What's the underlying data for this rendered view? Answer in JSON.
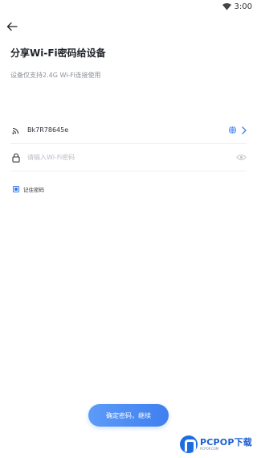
{
  "status_bar": {
    "time": "3:00",
    "icons": [
      "wifi-icon"
    ]
  },
  "nav": {
    "back_icon": "arrow-left-icon"
  },
  "header": {
    "title": "分享Wi-Fi密码给设备",
    "subtitle": "设备仅支持2.4G Wi-Fi连接使用"
  },
  "wifi_row": {
    "icon": "wifi-signal-icon",
    "ssid": "Bk7R78645e",
    "globe_icon": "globe-icon",
    "chevron_icon": "chevron-right-icon"
  },
  "password_row": {
    "icon": "lock-icon",
    "value": "",
    "placeholder": "请输入Wi-Fi密码",
    "eye_icon": "eye-icon"
  },
  "remember": {
    "label": "记住密码",
    "checked": true
  },
  "confirm_button": {
    "label": "确定密码，继续"
  },
  "watermark": {
    "text": "PCPOP下载",
    "subtext": "PCPOP.COM"
  },
  "colors": {
    "accent": "#3f7ff0",
    "accent_light": "#5c9bf8",
    "title": "#1f2329",
    "subtitle": "#8c9099",
    "placeholder": "#b8bcc4",
    "divider": "#eceef1"
  }
}
